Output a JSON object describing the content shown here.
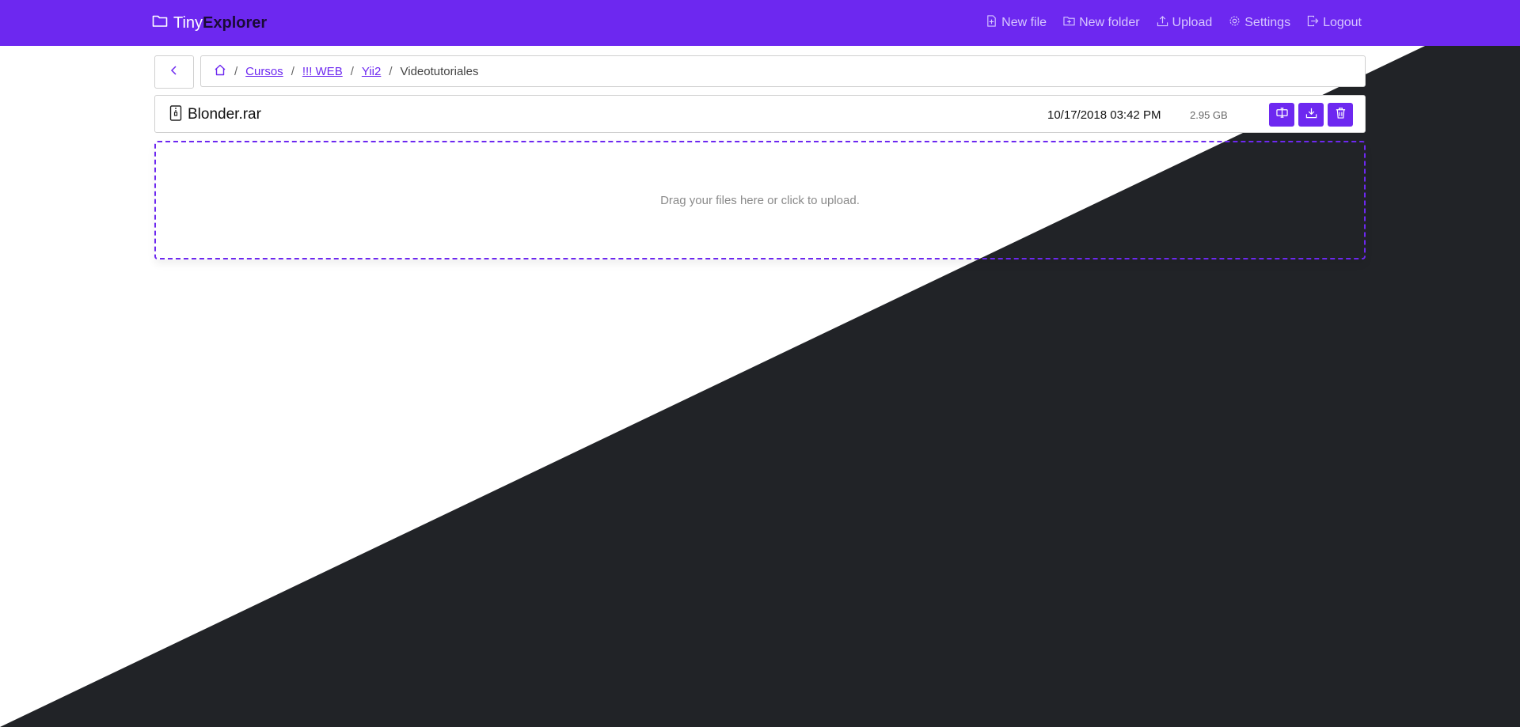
{
  "app": {
    "brand_light": "Tiny",
    "brand_bold": "Explorer"
  },
  "navbar": {
    "new_file": "New file",
    "new_folder": "New folder",
    "upload": "Upload",
    "settings": "Settings",
    "logout": "Logout"
  },
  "breadcrumb": {
    "items": [
      {
        "label": "Cursos"
      },
      {
        "label": "!!! WEB"
      },
      {
        "label": "Yii2"
      }
    ],
    "current": "Videotutoriales",
    "separator": "/"
  },
  "files": [
    {
      "name": "Blonder.rar",
      "modified": "10/17/2018 03:42 PM",
      "size": "2.95 GB"
    }
  ],
  "dropzone": {
    "text": "Drag your files here or click to upload."
  },
  "colors": {
    "accent": "#6d28f0",
    "dark_bg": "#212327"
  },
  "icons": {
    "brand": "folder-icon",
    "new_file": "file-plus-icon",
    "new_folder": "folder-plus-icon",
    "upload": "upload-icon",
    "settings": "gear-icon",
    "logout": "logout-icon",
    "back": "chevron-left-icon",
    "home": "home-icon",
    "file": "archive-file-icon",
    "rename": "rename-icon",
    "download": "download-icon",
    "delete": "trash-icon"
  }
}
